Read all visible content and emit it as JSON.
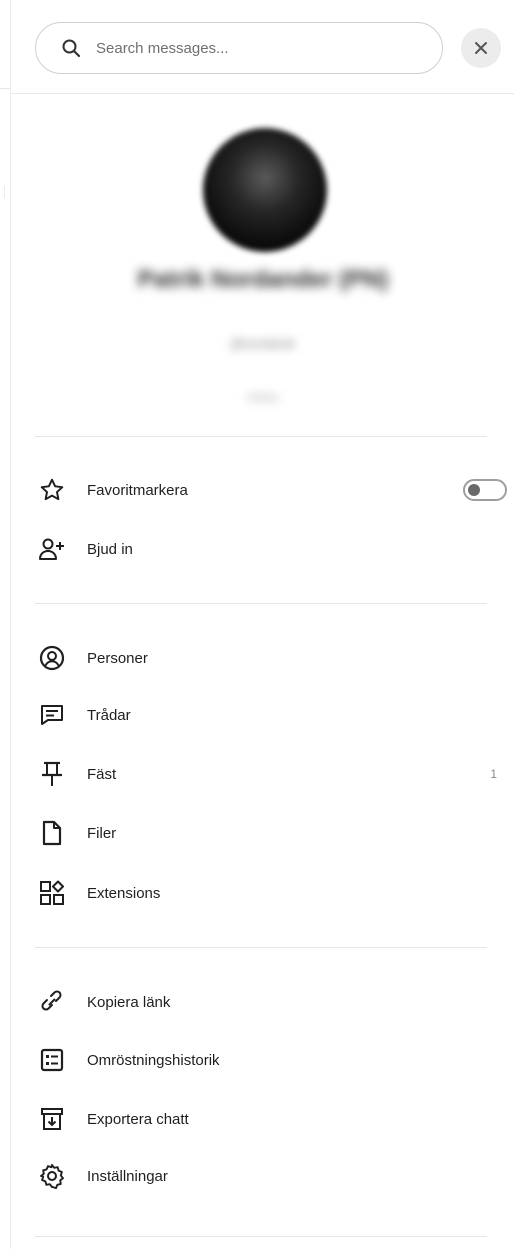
{
  "search": {
    "placeholder": "Search messages...",
    "value": ""
  },
  "profile": {
    "name": "Patrik Nordander (PN)",
    "handle": "@nordandr",
    "status": "Online"
  },
  "section1": [
    {
      "label": "Favoritmarkera",
      "icon": "star-icon",
      "toggle": false
    },
    {
      "label": "Bjud in",
      "icon": "add-user-icon"
    }
  ],
  "section2": [
    {
      "label": "Personer",
      "icon": "person-circle-icon"
    },
    {
      "label": "Trådar",
      "icon": "thread-icon"
    },
    {
      "label": "Fäst",
      "icon": "pin-icon",
      "count": "1"
    },
    {
      "label": "Filer",
      "icon": "file-icon"
    },
    {
      "label": "Extensions",
      "icon": "extensions-icon"
    }
  ],
  "section3": [
    {
      "label": "Kopiera länk",
      "icon": "link-icon"
    },
    {
      "label": "Omröstningshistorik",
      "icon": "poll-history-icon"
    },
    {
      "label": "Exportera chatt",
      "icon": "export-icon"
    },
    {
      "label": "Inställningar",
      "icon": "gear-icon"
    }
  ],
  "colors": {
    "accent_toggle": "#6a6a6a",
    "divider": "#e6e6e6",
    "close_bg": "#ececec"
  }
}
